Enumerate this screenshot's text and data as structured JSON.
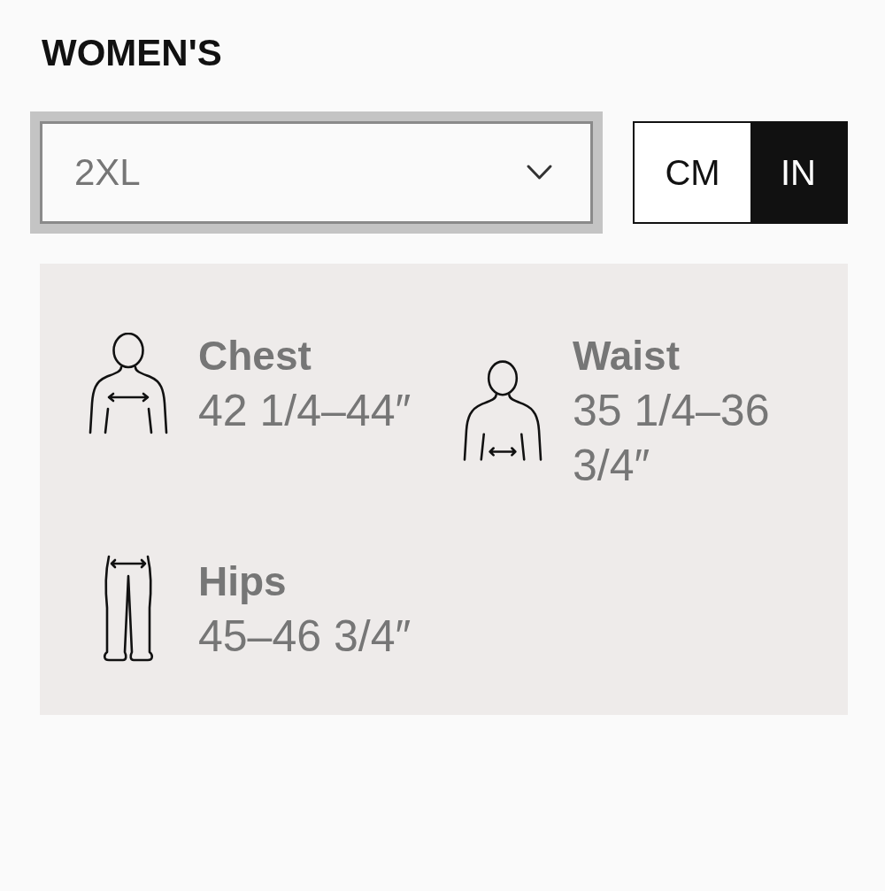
{
  "heading": "WOMEN'S",
  "size_select": {
    "value": "2XL",
    "focused": true
  },
  "units": [
    {
      "label": "CM",
      "selected": false
    },
    {
      "label": "IN",
      "selected": true
    }
  ],
  "measurements": [
    {
      "kind": "chest",
      "label": "Chest",
      "value": "42 1/4–44″"
    },
    {
      "kind": "waist",
      "label": "Waist",
      "value": "35 1/4–36 3/4″"
    },
    {
      "kind": "hips",
      "label": "Hips",
      "value": "45–46 3/4″"
    }
  ]
}
